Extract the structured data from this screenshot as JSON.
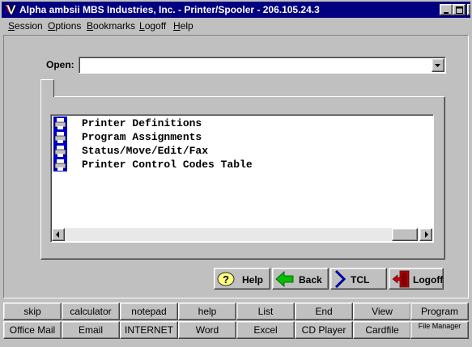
{
  "window": {
    "title": "Alpha ambsii MBS Industries, Inc. - Printer/Spooler - 206.105.24.3",
    "controls": [
      "minimize-icon",
      "maximize-icon",
      "close-icon"
    ]
  },
  "menubar": {
    "items": [
      {
        "label": "Session",
        "accel": "S",
        "rest": "ession"
      },
      {
        "label": "Options",
        "accel": "O",
        "rest": "ptions"
      },
      {
        "label": "Bookmarks",
        "accel": "B",
        "rest": "ookmarks"
      },
      {
        "label": "Logoff",
        "accel": "L",
        "rest": "ogoff"
      },
      {
        "label": "Help",
        "accel": "H",
        "rest": "elp"
      }
    ]
  },
  "open": {
    "label": "Open:",
    "value": "",
    "dropdown_icon": "chevron-down-icon"
  },
  "list": {
    "items": [
      {
        "label": "Printer Definitions",
        "icon": "printer-icon"
      },
      {
        "label": "Program Assignments",
        "icon": "printer-icon"
      },
      {
        "label": "Status/Move/Edit/Fax",
        "icon": "printer-icon"
      },
      {
        "label": "Printer Control Codes Table",
        "icon": "printer-icon"
      }
    ]
  },
  "actions": {
    "help": {
      "label": "Help",
      "icon": "help-question-icon"
    },
    "back": {
      "label": "Back",
      "icon": "back-arrow-icon"
    },
    "tcl": {
      "label": "TCL",
      "icon": "tcl-chevron-icon"
    },
    "logoff": {
      "label": "Logoff",
      "icon": "exit-door-icon"
    }
  },
  "quickbar": {
    "row1": [
      "skip",
      "calculator",
      "notepad",
      "help",
      "List",
      "End",
      "View",
      "Program"
    ],
    "row2": [
      "Office Mail",
      "Email",
      "INTERNET",
      "Word",
      "Excel",
      "CD Player",
      "Cardfile",
      "File Manager"
    ]
  },
  "colors": {
    "titlebar": "#000080",
    "face": "#c0c0c0",
    "list_icon_blue": "#0000c0"
  }
}
